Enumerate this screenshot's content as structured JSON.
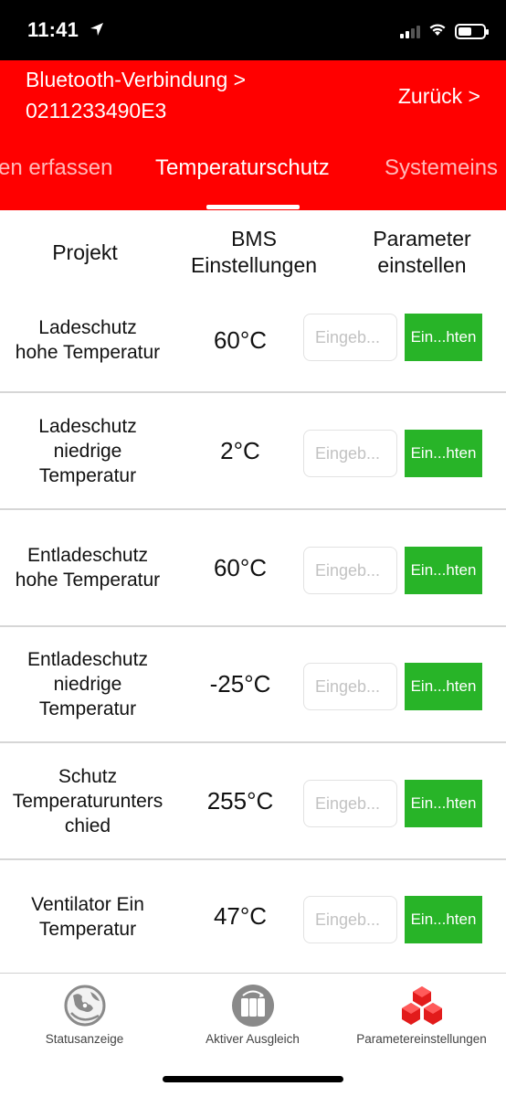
{
  "status_bar": {
    "time": "11:41",
    "location_icon": "location-arrow-icon"
  },
  "header": {
    "connection_label": "Bluetooth-Verbindung >",
    "device_id": "0211233490E3",
    "back_label": "Zurück >",
    "tabs": [
      {
        "label": "en erfassen",
        "active": false
      },
      {
        "label": "Temperaturschutz",
        "active": true
      },
      {
        "label": "Systemeins",
        "active": false
      }
    ]
  },
  "columns": {
    "project": "Projekt",
    "bms_line1": "BMS",
    "bms_line2": "Einstellungen",
    "param_line1": "Parameter",
    "param_line2": "einstellen"
  },
  "rows": [
    {
      "label": [
        "Ladeschutz",
        "hohe Temperatur"
      ],
      "value": "60°C",
      "input_placeholder": "Eingeb...",
      "button_label": "Ein...hten"
    },
    {
      "label": [
        "Ladeschutz",
        "niedrige",
        "Temperatur"
      ],
      "value": "2°C",
      "input_placeholder": "Eingeb...",
      "button_label": "Ein...hten"
    },
    {
      "label": [
        "Entladeschutz",
        "hohe Temperatur"
      ],
      "value": "60°C",
      "input_placeholder": "Eingeb...",
      "button_label": "Ein...hten"
    },
    {
      "label": [
        "Entladeschutz",
        "niedrige",
        "Temperatur"
      ],
      "value": "-25°C",
      "input_placeholder": "Eingeb...",
      "button_label": "Ein...hten"
    },
    {
      "label": [
        "Schutz",
        "Temperaturunters",
        "chied"
      ],
      "value": "255°C",
      "input_placeholder": "Eingeb...",
      "button_label": "Ein...hten"
    },
    {
      "label": [
        "Ventilator Ein",
        "Temperatur"
      ],
      "value": "47°C",
      "input_placeholder": "Eingeb...",
      "button_label": "Ein...hten"
    }
  ],
  "tabbar": [
    {
      "label": "Statusanzeige",
      "icon": "globe-status-icon",
      "active": false
    },
    {
      "label": "Aktiver Ausgleich",
      "icon": "battery-balance-icon",
      "active": false
    },
    {
      "label": "Parametereinstellungen",
      "icon": "cubes-settings-icon",
      "active": true
    }
  ],
  "colors": {
    "header_red": "#ff0000",
    "button_green": "#28b428",
    "active_icon_red": "#e21b1b",
    "inactive_icon_gray": "#8a8a8a"
  }
}
